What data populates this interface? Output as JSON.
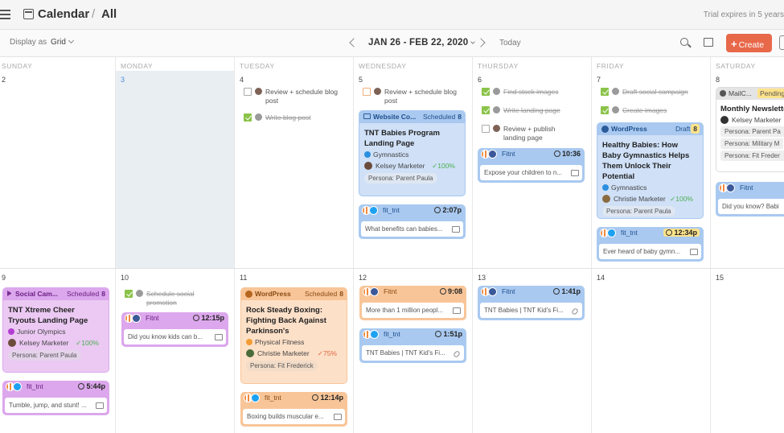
{
  "header": {
    "app": "Calendar",
    "separator": "/",
    "view": "All",
    "trial": "Trial expires in 5 years"
  },
  "toolbar": {
    "display_as": "Display as",
    "display_value": "Grid",
    "range": "JAN 26 - FEB 22, 2020",
    "today": "Today",
    "create": "Create",
    "create_plus": "+"
  },
  "days": [
    "SUNDAY",
    "MONDAY",
    "TUESDAY",
    "WEDNESDAY",
    "THURSDAY",
    "FRIDAY",
    "SATURDAY"
  ],
  "week1": [
    "2",
    "3",
    "4",
    "5",
    "6",
    "7",
    "8"
  ],
  "week2": [
    "9",
    "10",
    "11",
    "12",
    "13",
    "14",
    "15"
  ],
  "tasks": {
    "tue1": "Review + schedule blog post",
    "tue2": "Write blog post",
    "wed1": "Review + schedule blog post",
    "thu1": "Find stock images",
    "thu2": "Write landing page",
    "thu3": "Review + publish landing page",
    "fri1": "Draft social campaign",
    "fri2": "Create images",
    "mon2": "Schedule social promotion"
  },
  "cards": {
    "wed_web": {
      "type": "Website Co...",
      "status": "Scheduled",
      "count": "8",
      "title": "TNT Babies Program Landing Page",
      "tag": "Gymnastics",
      "owner": "Kelsey Marketer",
      "pct": "✓100%",
      "persona": "Persona: Parent Paula"
    },
    "wed_tw": {
      "account": "fit_tnt",
      "time": "2:07p",
      "text": "What benefits can babies..."
    },
    "thu_fb": {
      "account": "Fitnt",
      "time": "10:36",
      "text": "Expose your children to n..."
    },
    "fri_wp": {
      "type": "WordPress",
      "status": "Draft",
      "count": "8",
      "title": "Healthy Babies: How Baby Gymnastics Helps Them Unlock Their Potential",
      "tag": "Gymnastics",
      "owner": "Christie Marketer",
      "pct": "✓100%",
      "persona": "Persona: Parent Paula"
    },
    "fri_tw": {
      "account": "fit_tnt",
      "time": "12:34p",
      "text": "Ever heard of baby gymn..."
    },
    "sat_mail": {
      "type": "MailC...",
      "status": "Pending",
      "title": "Monthly Newsletter",
      "owner": "Kelsey Marketer",
      "p1": "Persona: Parent Pa",
      "p2": "Persona: Military M",
      "p3": "Persona: Fit Freder"
    },
    "sat_fb": {
      "account": "Fitnt",
      "text": "Did you know? Babi"
    },
    "sun_social": {
      "type": "Social Cam...",
      "status": "Scheduled",
      "count": "8",
      "title": "TNT Xtreme Cheer Tryouts Landing Page",
      "tag": "Junior Olympics",
      "owner": "Kelsey Marketer",
      "pct": "✓100%",
      "persona": "Persona: Parent Paula"
    },
    "sun_tw": {
      "account": "fit_tnt",
      "time": "5:44p",
      "text": "Tumble, jump, and stunt! ..."
    },
    "mon_fb": {
      "account": "Fitnt",
      "time": "12:15p",
      "text": "Did you know kids can b..."
    },
    "tue_wp": {
      "type": "WordPress",
      "status": "Scheduled",
      "count": "8",
      "title": "Rock Steady Boxing: Fighting Back Against Parkinson's",
      "tag": "Physical Fitness",
      "owner": "Christie Marketer",
      "pct": "✓75%",
      "persona": "Persona: Fit Frederick"
    },
    "tue_tw": {
      "account": "fit_tnt",
      "time": "12:14p",
      "text": "Boxing builds muscular e..."
    },
    "wed_fb": {
      "account": "Fitnt",
      "time": "9:08",
      "text": "More than 1 million peopl..."
    },
    "wed_tw2": {
      "account": "fit_tnt",
      "time": "1:51p",
      "text": "TNT Babies | TNT Kid's Fi..."
    },
    "thu_fb2": {
      "account": "Fitnt",
      "time": "1:41p",
      "text": "TNT Babies | TNT Kid's Fi..."
    }
  },
  "colors": {
    "blue": "#cfe0f7",
    "blue_head": "#a9c9f0",
    "purple": "#ebc9f3",
    "purple_head": "#dca7ec",
    "orange": "#fde0c8",
    "orange_head": "#f8c598",
    "gray": "#e8e8e8",
    "accent": "#e8684a"
  }
}
